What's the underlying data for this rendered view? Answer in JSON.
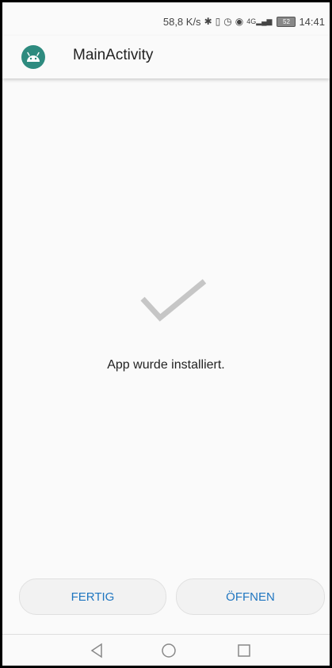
{
  "status_bar": {
    "network_speed": "58,8 K/s",
    "signal_label": "4G",
    "battery_level": "52",
    "time": "14:41"
  },
  "app_bar": {
    "title": "MainActivity",
    "icon": "android-icon"
  },
  "content": {
    "icon": "checkmark-icon",
    "message": "App wurde installiert."
  },
  "actions": {
    "done_label": "FERTIG",
    "open_label": "ÖFFNEN"
  },
  "nav_bar": {
    "back_icon": "back-icon",
    "home_icon": "home-icon",
    "recent_icon": "recent-apps-icon"
  },
  "colors": {
    "accent": "#1f76c0",
    "app_icon_bg": "#2e8b7f",
    "check": "#c6c6c6"
  }
}
